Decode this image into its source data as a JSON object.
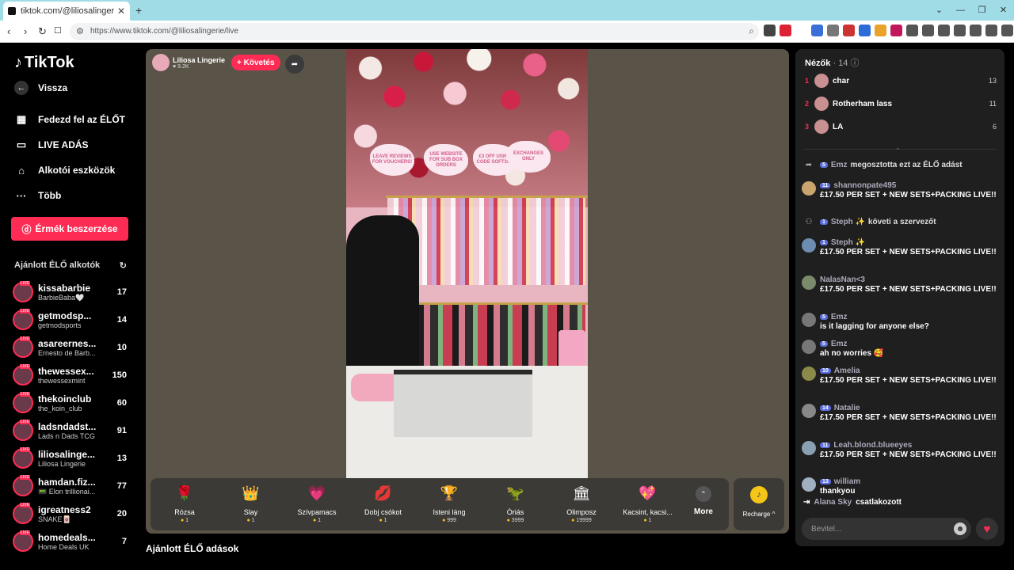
{
  "browser": {
    "tab_title": "tiktok.com/@liliosalingerie/li",
    "url": "https://www.tiktok.com/@liliosalingerie/live",
    "nav_back": "‹",
    "nav_forward": "›",
    "nav_reload": "↻",
    "new_tab": "+",
    "win_minimize": "—",
    "win_restore": "❐",
    "win_close": "✕"
  },
  "sidebar": {
    "logo": "TikTok",
    "back": "Vissza",
    "nav": [
      {
        "label": "Fedezd fel az ÉLŐT",
        "icon": "calendar-live-icon"
      },
      {
        "label": "LIVE ADÁS",
        "icon": "video-camera-icon"
      },
      {
        "label": "Alkotói eszközök",
        "icon": "creator-tools-icon"
      },
      {
        "label": "Több",
        "icon": "more-dots-icon"
      }
    ],
    "coins_button": "Érmék beszerzése",
    "recommended_title": "Ajánlott ÉLŐ alkotók",
    "live_badge": "LIVE",
    "recommended": [
      {
        "name": "kissabarbie",
        "sub": "BarbieBaba🤍",
        "count": "17"
      },
      {
        "name": "getmodsp...",
        "sub": "getmodsports",
        "count": "14"
      },
      {
        "name": "asareernes...",
        "sub": "Ernesto de Barb...",
        "count": "10"
      },
      {
        "name": "thewessex...",
        "sub": "thewessexmint",
        "count": "150"
      },
      {
        "name": "thekoinclub",
        "sub": "the_koin_club",
        "count": "60"
      },
      {
        "name": "ladsndadst...",
        "sub": "Lads n Dads TCG",
        "count": "91"
      },
      {
        "name": "liliosalinge...",
        "sub": "Liliosa Lingerie",
        "count": "13"
      },
      {
        "name": "hamdan.fiz...",
        "sub": "📟 Elon trillionai...",
        "count": "77"
      },
      {
        "name": "igreatness2",
        "sub": "SNAKE🀄",
        "count": "20"
      },
      {
        "name": "homedeals...",
        "sub": "Home Deals UK",
        "count": "7"
      }
    ]
  },
  "stream": {
    "host_name": "Liliosa Lingerie",
    "host_likes": "♥ 9.2K",
    "follow_label": "+ Követés",
    "signs": [
      "LEAVE REVIEWS FOR VOUCHERS!",
      "USE WEBSITE FOR SUB BOX ORDERS",
      "£3 OFF USING CODE SOFT3UK",
      "EXCHANGES ONLY"
    ],
    "gifts": [
      {
        "name": "Rózsa",
        "price": "1",
        "icon": "🌹"
      },
      {
        "name": "Slay",
        "price": "1",
        "icon": "👑"
      },
      {
        "name": "Szívpamacs",
        "price": "1",
        "icon": "💗"
      },
      {
        "name": "Dobj csókot",
        "price": "1",
        "icon": "💋"
      },
      {
        "name": "Isteni láng",
        "price": "999",
        "icon": "🏆"
      },
      {
        "name": "Óriás",
        "price": "3999",
        "icon": "🦖"
      },
      {
        "name": "Olimposz",
        "price": "19999",
        "icon": "🏛"
      },
      {
        "name": "Kacsint, kacsi...",
        "price": "1",
        "icon": "💖"
      }
    ],
    "more_label": "More",
    "recharge_label": "Recharge ^",
    "recommended_lives": "Ajánlott ÉLŐ adások"
  },
  "chat": {
    "viewers_title": "Nézők",
    "viewers_count": "· 14",
    "top_viewers": [
      {
        "rank": "1",
        "name": "char",
        "score": "13"
      },
      {
        "rank": "2",
        "name": "Rotherham lass",
        "score": "11"
      },
      {
        "rank": "3",
        "name": "LA",
        "score": "6"
      }
    ],
    "messages": [
      {
        "level": "5",
        "user": "Emz",
        "text": "megosztotta ezt az ÉLŐ adást",
        "kind": "system"
      },
      {
        "level": "11",
        "user": "shannonpate495",
        "text": "£17.50 PER SET + NEW SETS+PACKING LIVE!!",
        "kind": "msg"
      },
      {
        "level": "1",
        "user": "Steph ✨",
        "text": "követi a szervezőt",
        "kind": "system"
      },
      {
        "level": "1",
        "user": "Steph ✨",
        "text": "£17.50 PER SET + NEW SETS+PACKING LIVE!!",
        "kind": "msg"
      },
      {
        "level": "",
        "user": "NalasNan<3",
        "text": "£17.50 PER SET + NEW SETS+PACKING LIVE!!",
        "kind": "msg"
      },
      {
        "level": "5",
        "user": "Emz",
        "text": "is it lagging for anyone else?",
        "kind": "msg"
      },
      {
        "level": "5",
        "user": "Emz",
        "text": "ah no worries 🥰",
        "kind": "msg"
      },
      {
        "level": "10",
        "user": "Amelia",
        "text": "£17.50 PER SET + NEW SETS+PACKING LIVE!!",
        "kind": "msg"
      },
      {
        "level": "14",
        "user": "Natalie",
        "text": "£17.50 PER SET + NEW SETS+PACKING LIVE!!",
        "kind": "msg"
      },
      {
        "level": "11",
        "user": "Leah.blond.blueeyes",
        "text": "£17.50 PER SET + NEW SETS+PACKING LIVE!!",
        "kind": "msg"
      },
      {
        "level": "13",
        "user": "william",
        "text": "thankyou",
        "kind": "msg"
      }
    ],
    "joined_user": "Alana Sky",
    "joined_text": "csatlakozott",
    "input_placeholder": "Bevitel..."
  }
}
